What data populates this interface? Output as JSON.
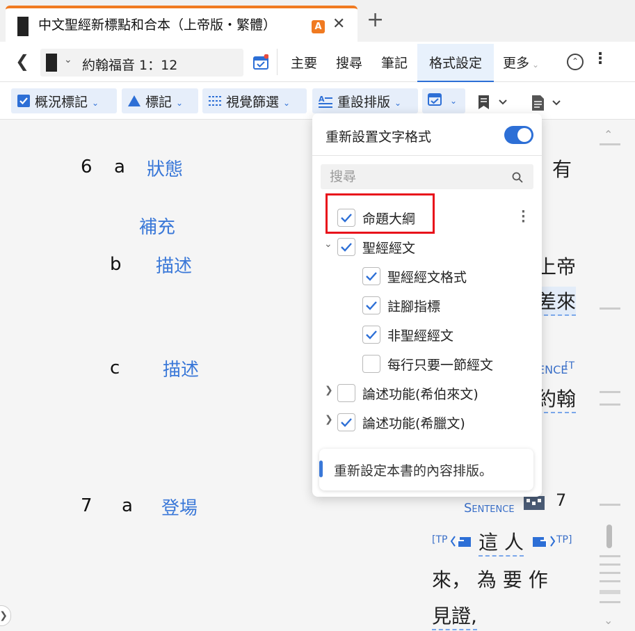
{
  "tab": {
    "title": "中文聖經新標點和合本（上帝版・繁體）",
    "badge": "A",
    "close": "✕",
    "new_tab": "+"
  },
  "nav": {
    "reference": "約翰福音 1：12",
    "tabs": [
      "主要",
      "搜尋",
      "筆記",
      "格式設定",
      "更多"
    ],
    "active_tab": "格式設定"
  },
  "toolbar": {
    "survey": "概況標記",
    "mark": "標記",
    "visual_filter": "視覺篩選",
    "reset_layout": "重設排版"
  },
  "content": {
    "left": [
      {
        "num": "6",
        "letter": "a",
        "label": "狀態"
      },
      {
        "label": "補充"
      },
      {
        "letter": "b",
        "label": "描述"
      },
      {
        "letter": "c",
        "label": "描述"
      },
      {
        "num": "7",
        "letter": "a",
        "label": "登場"
      }
    ],
    "right": {
      "t1": "有",
      "t2": "上帝",
      "t3": "差來",
      "t4": "ENCE",
      "t4b": "[T",
      "t5": "約翰",
      "sentence": "Sentence",
      "verse7": "7",
      "tp_open": "[TP",
      "tp_word": "這 人",
      "tp_close": "TP]",
      "t6": "來， 為 要 作",
      "t7": "見證,"
    }
  },
  "panel": {
    "title": "重新設置文字格式",
    "toggle_on": true,
    "search_placeholder": "搜尋",
    "items": [
      {
        "label": "命題大綱",
        "checked": true
      },
      {
        "label": "聖經經文",
        "checked": true
      },
      {
        "label": "聖經經文格式",
        "checked": true
      },
      {
        "label": "註腳指標",
        "checked": true
      },
      {
        "label": "非聖經經文",
        "checked": true
      },
      {
        "label": "每行只要一節經文",
        "checked": false
      },
      {
        "label": "論述功能(希伯來文)",
        "checked": false
      },
      {
        "label": "論述功能(希臘文)",
        "checked": true
      }
    ],
    "note": "重新設定本書的內容排版。"
  },
  "colors": {
    "accent": "#2d6fd6",
    "tab_accent": "#f07a21",
    "highlight_red": "#e8121b",
    "label_blue": "#3a78d8"
  }
}
